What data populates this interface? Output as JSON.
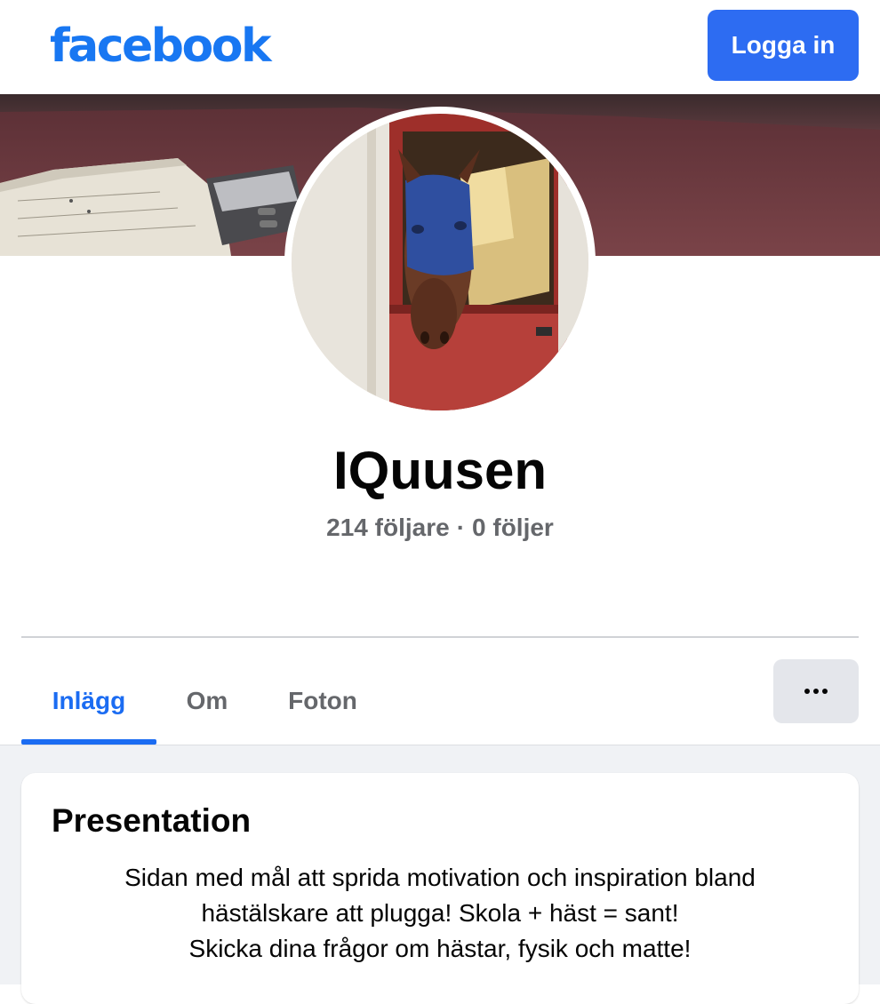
{
  "header": {
    "logo_text": "facebook",
    "login_label": "Logga in",
    "brand_color": "#1877f2",
    "button_color": "#2d6cf2"
  },
  "profile": {
    "name": "IQuusen",
    "followers": "214 följare",
    "separator": "·",
    "following": "0 följer"
  },
  "tabs": [
    {
      "label": "Inlägg",
      "active": true
    },
    {
      "label": "Om",
      "active": false
    },
    {
      "label": "Foton",
      "active": false
    }
  ],
  "more_button_icon": "more-dots-icon",
  "intro": {
    "title": "Presentation",
    "bio_lines": [
      "Sidan med mål att sprida motivation och inspiration bland",
      "hästälskare att plugga! Skola + häst = sant!",
      "Skicka dina frågor om hästar, fysik och matte!"
    ]
  }
}
